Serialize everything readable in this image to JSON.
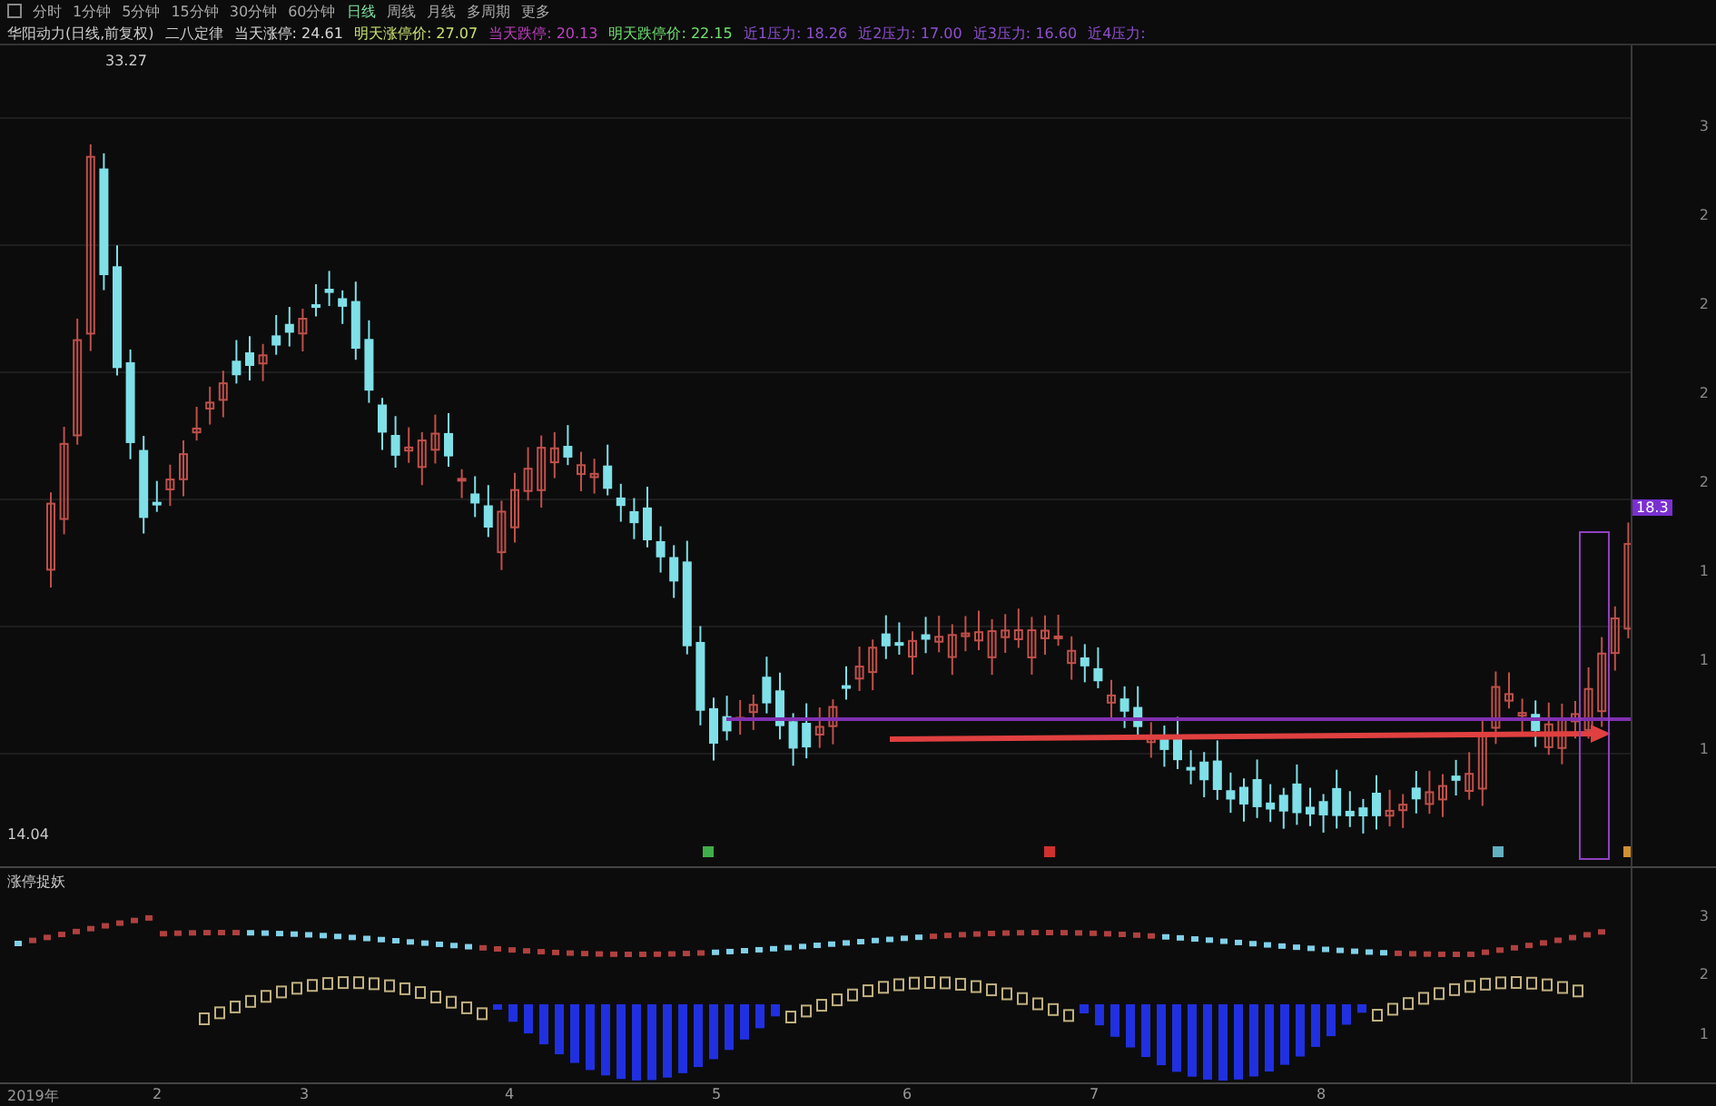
{
  "period_tabs": [
    {
      "label": "分时",
      "selected": false
    },
    {
      "label": "1分钟",
      "selected": false
    },
    {
      "label": "5分钟",
      "selected": false
    },
    {
      "label": "15分钟",
      "selected": false
    },
    {
      "label": "30分钟",
      "selected": false
    },
    {
      "label": "60分钟",
      "selected": false
    },
    {
      "label": "日线",
      "selected": true
    },
    {
      "label": "周线",
      "selected": false
    },
    {
      "label": "月线",
      "selected": false
    },
    {
      "label": "多周期",
      "selected": false
    },
    {
      "label": "更多",
      "selected": false
    }
  ],
  "info_bar": {
    "title": "华阳动力(日线,前复权)",
    "indicator": "二八定律",
    "items": [
      {
        "text": "当天涨停: 24.61",
        "color": "#d8d8d8"
      },
      {
        "text": "明天涨停价: 27.07",
        "color": "#c8e070"
      },
      {
        "text": "当天跌停: 20.13",
        "color": "#c040c0"
      },
      {
        "text": "明天跌停价: 22.15",
        "color": "#70e070"
      },
      {
        "text": "近1压力: 18.26",
        "color": "#9050d0"
      },
      {
        "text": "近2压力: 17.00",
        "color": "#9050d0"
      },
      {
        "text": "近3压力: 16.60",
        "color": "#9050d0"
      },
      {
        "text": "近4压力:",
        "color": "#9050d0"
      }
    ]
  },
  "price_chart": {
    "high_label": "33.27",
    "low_label": "14.04",
    "price_tag": "18.3",
    "signals": [
      {
        "color": "#3fae4a"
      },
      {
        "color": "#d03030"
      },
      {
        "color": "#60b0c0"
      },
      {
        "color": "#d09030"
      }
    ]
  },
  "right_axis": [
    "3",
    "2",
    "2",
    "2",
    "2",
    "1",
    "1",
    "1"
  ],
  "indicator_panel": {
    "title": "涨停捉妖",
    "axis": [
      "3",
      "2",
      "1"
    ]
  },
  "time_axis": [
    "2019年",
    "2",
    "3",
    "4",
    "5",
    "6",
    "7",
    "8"
  ]
}
